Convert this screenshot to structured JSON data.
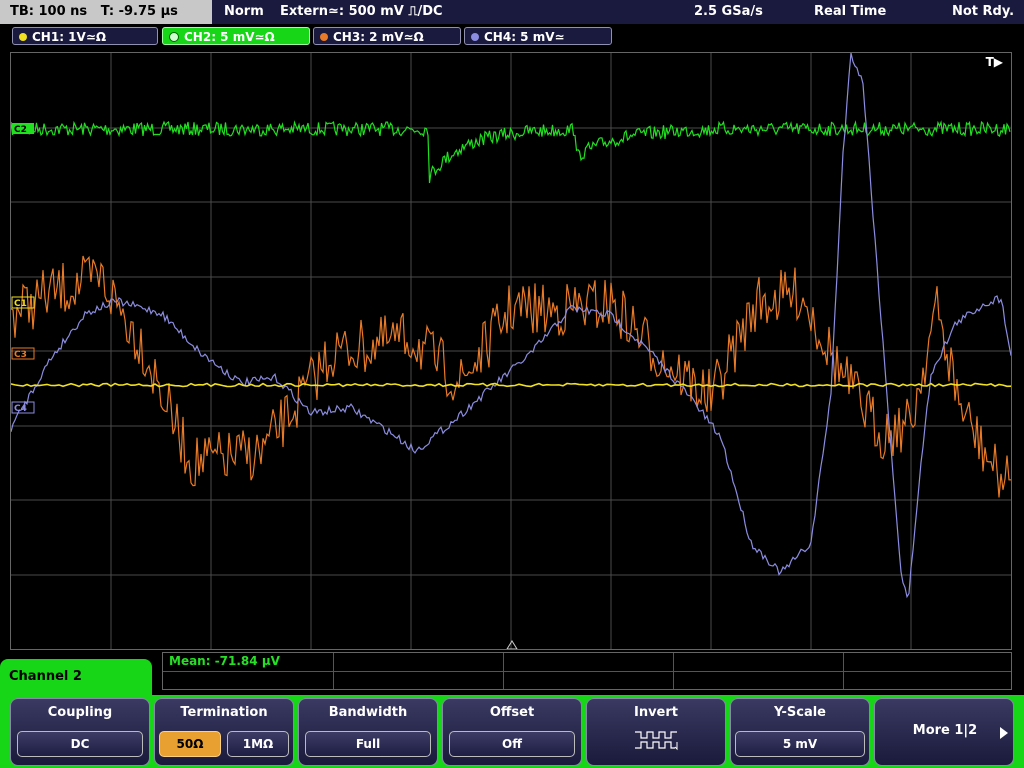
{
  "status": {
    "timebase": "TB: 100 ns",
    "trigger_time": "T: -9.75 µs",
    "mode": "Norm",
    "trigger_source": "Extern≃: 500 mV ⎍/DC",
    "sample_rate": "2.5 GSa/s",
    "acquisition": "Real Time",
    "ready_state": "Not Rdy."
  },
  "channels": [
    {
      "label": "CH1: 1V≃Ω",
      "color": "#f0e020"
    },
    {
      "label": "CH2: 5 mV≃Ω",
      "color": "#20e020"
    },
    {
      "label": "CH3: 2 mV≃Ω",
      "color": "#e87a28"
    },
    {
      "label": "CH4: 5 mV≃",
      "color": "#8c8ce0"
    }
  ],
  "markers": {
    "c2": "C2",
    "c1": "C1",
    "c3": "C3",
    "c4": "C4",
    "trigger": "T▶"
  },
  "measurement": {
    "text": "Mean: -71.84 µV"
  },
  "menu": {
    "title": "Channel 2",
    "coupling": {
      "label": "Coupling",
      "value": "DC"
    },
    "termination": {
      "label": "Termination",
      "opt1": "50Ω",
      "opt2": "1MΩ"
    },
    "bandwidth": {
      "label": "Bandwidth",
      "value": "Full"
    },
    "offset": {
      "label": "Offset",
      "value": "Off"
    },
    "invert": {
      "label": "Invert",
      "icon": "invert-waveform-icon"
    },
    "yscale": {
      "label": "Y-Scale",
      "value": "5 mV"
    },
    "more": {
      "label": "More 1|2"
    }
  },
  "colors": {
    "accent_green": "#17d517",
    "grid": "#4a4a4a"
  }
}
